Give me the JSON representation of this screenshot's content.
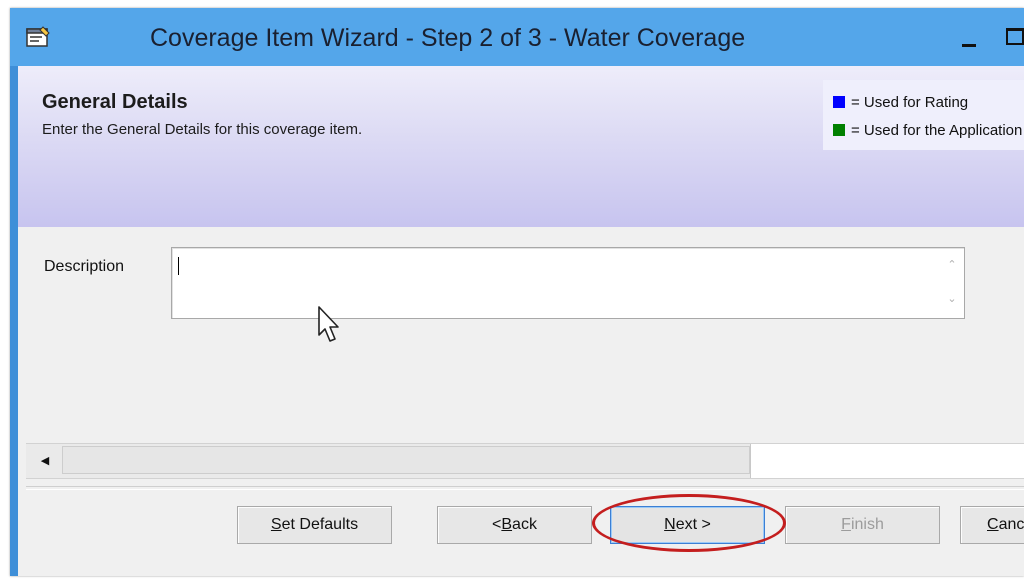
{
  "window": {
    "title": "Coverage Item Wizard - Step 2 of 3 - Water Coverage"
  },
  "header": {
    "title": "General Details",
    "subtitle": "Enter the General Details for this coverage item."
  },
  "legend": {
    "items": [
      {
        "label": "= Used for Rating",
        "color": "#0000ff"
      },
      {
        "label": "= Used for the Application",
        "color": "#008000"
      }
    ]
  },
  "form": {
    "description_label": "Description",
    "description_value": ""
  },
  "buttons": {
    "set_defaults": {
      "accel": "S",
      "rest": "et Defaults"
    },
    "back": {
      "prefix": "<",
      "accel": "B",
      "rest": "ack"
    },
    "next": {
      "accel": "N",
      "rest": "ext >"
    },
    "finish": {
      "accel": "F",
      "rest": "inish"
    },
    "cancel": {
      "accel": "C",
      "rest": "ancel"
    }
  },
  "colors": {
    "titlebar": "#54a6ea",
    "header_gradient_end": "#c7c4ef",
    "highlight": "#c41e1e"
  },
  "icons": {
    "app": "wizard-form-icon",
    "minimize": "minimize-icon",
    "maximize": "maximize-icon"
  }
}
